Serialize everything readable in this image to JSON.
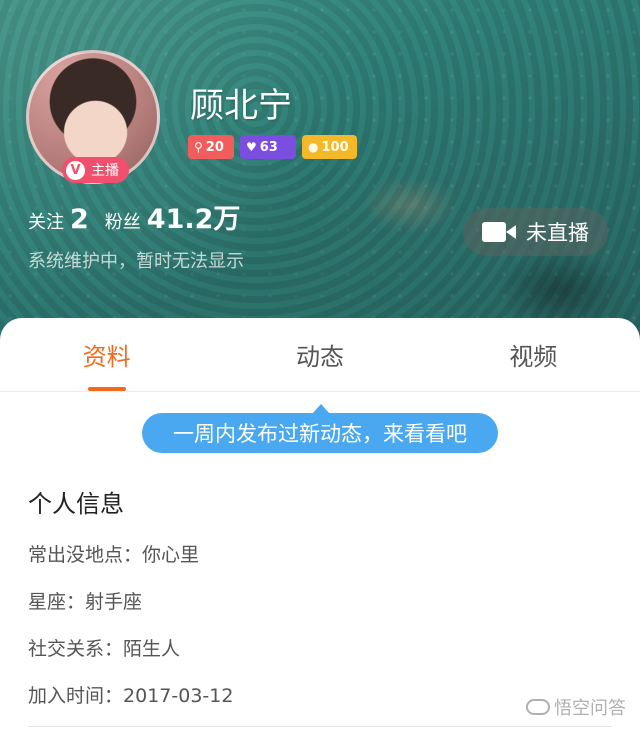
{
  "profile": {
    "username": "顾北宁",
    "anchor_badge": "主播",
    "anchor_badge_icon": "V",
    "levels": [
      {
        "icon": "wealth-level-icon",
        "value": "20",
        "color": "#f15c5c"
      },
      {
        "icon": "fan-level-icon",
        "value": "63",
        "color": "#7b4ee0"
      },
      {
        "icon": "coin-level-icon",
        "value": "100",
        "color": "#f4b92a"
      }
    ],
    "following_label": "关注",
    "following_count": "2",
    "fans_label": "粉丝",
    "fans_count": "41.2万",
    "notice": "系统维护中，暂时无法显示",
    "live_status": "未直播"
  },
  "tabs": [
    {
      "label": "资料",
      "active": true
    },
    {
      "label": "动态",
      "active": false
    },
    {
      "label": "视频",
      "active": false
    }
  ],
  "tooltip": "一周内发布过新动态，来看看吧",
  "info": {
    "title": "个人信息",
    "rows": [
      {
        "label": "常出没地点：",
        "value": "你心里"
      },
      {
        "label": "星座：",
        "value": "射手座"
      },
      {
        "label": "社交关系：",
        "value": "陌生人"
      },
      {
        "label": "加入时间：",
        "value": "2017-03-12"
      }
    ]
  },
  "watermark": "悟空问答",
  "colors": {
    "accent": "#f26a1b",
    "tooltip": "#4aa8f0",
    "anchor_badge": "#f0506e"
  }
}
